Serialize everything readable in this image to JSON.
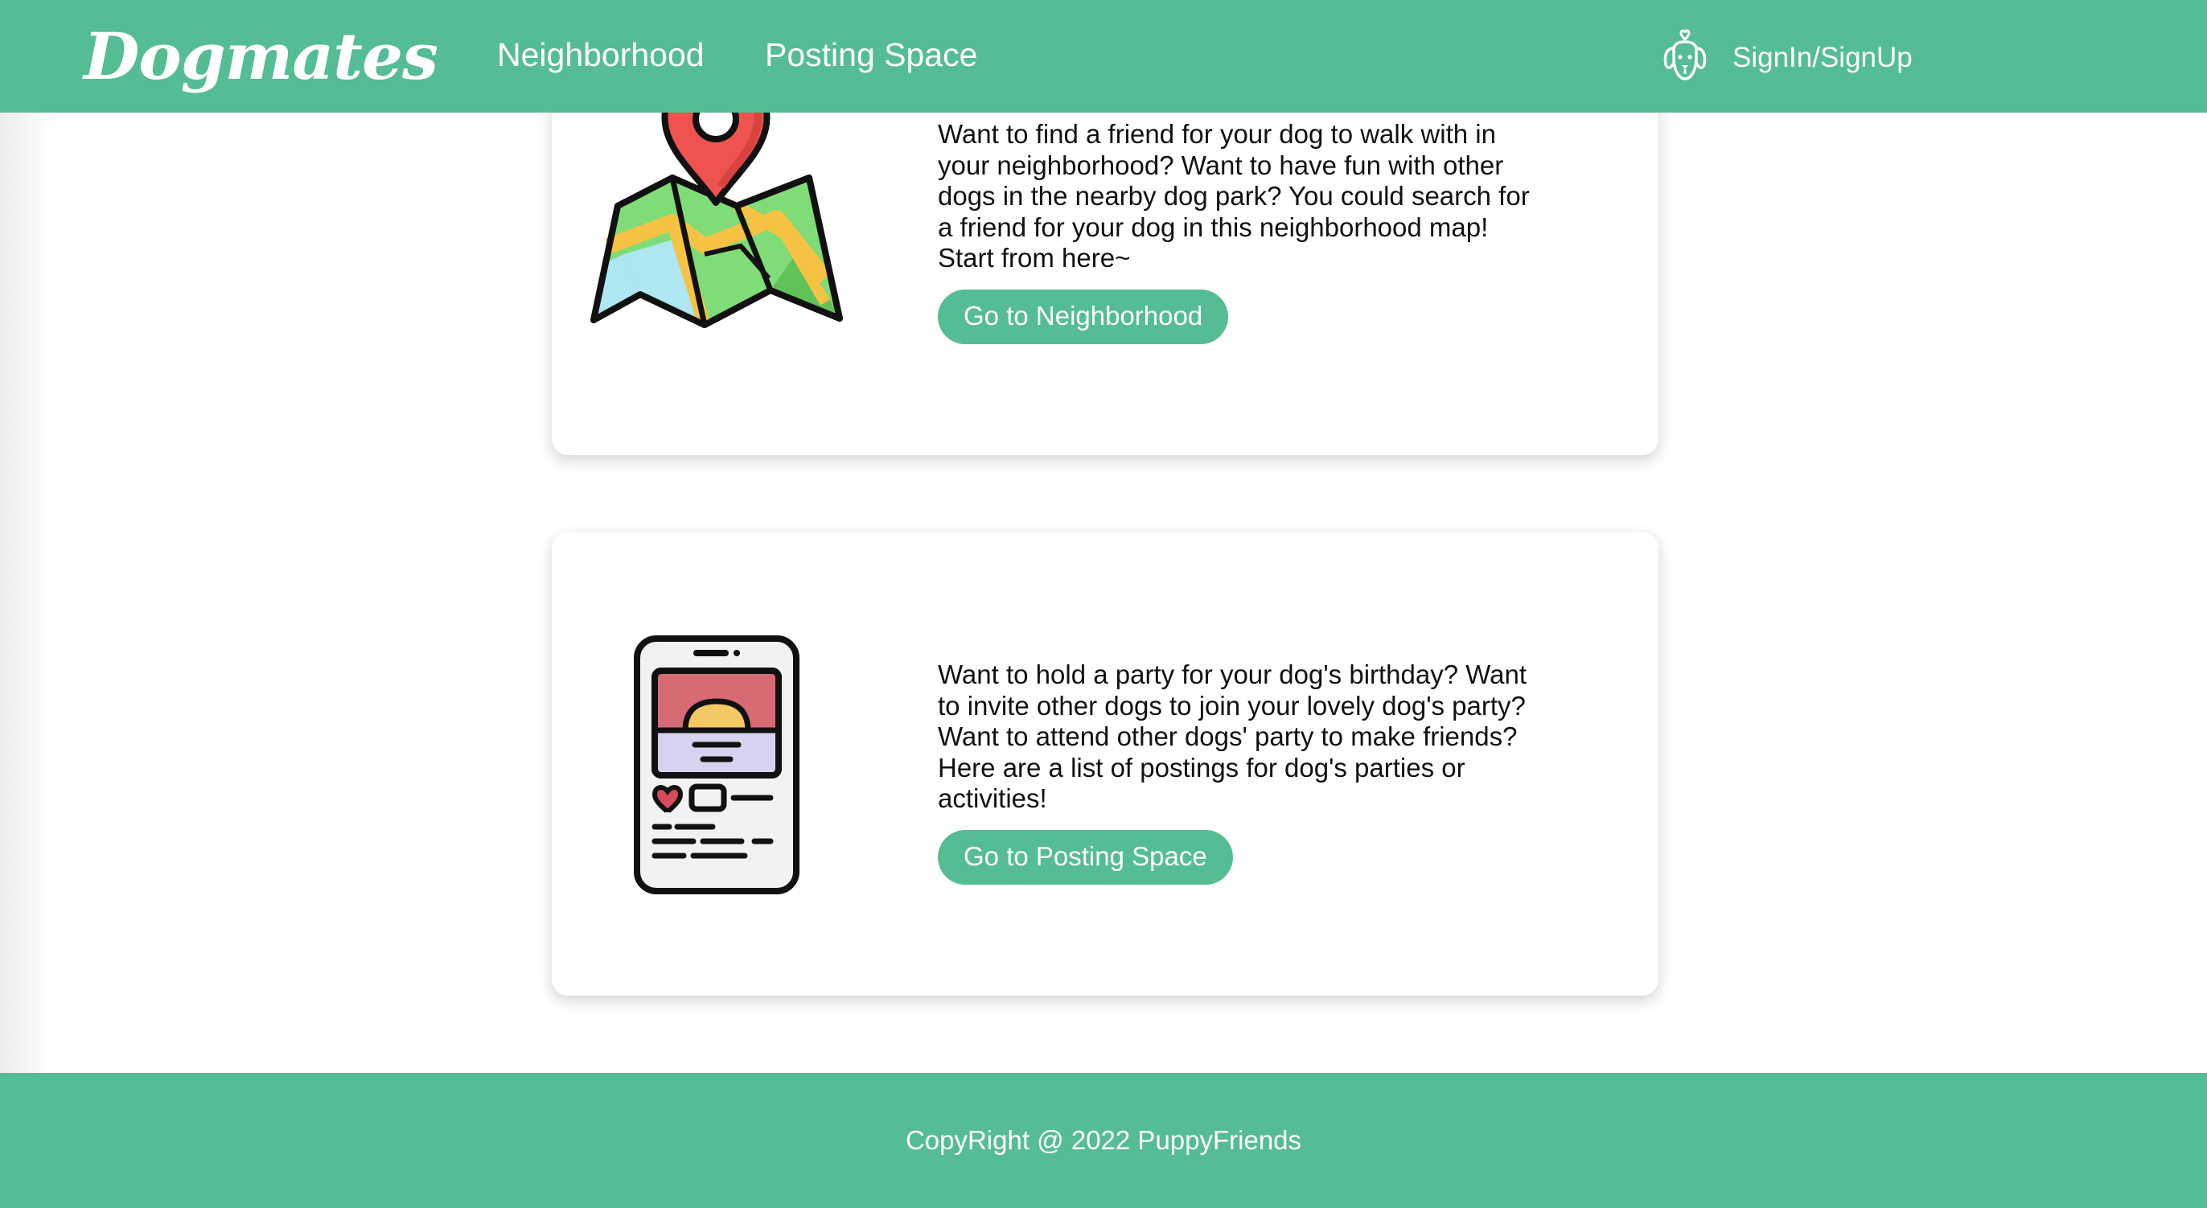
{
  "brand": {
    "name": "Dogmates"
  },
  "nav": {
    "links": [
      {
        "label": "Neighborhood"
      },
      {
        "label": "Posting Space"
      }
    ],
    "auth": {
      "label": "SignIn/SignUp",
      "icon": "dog-face-icon"
    }
  },
  "cards": [
    {
      "icon": "map-pin-icon",
      "text": "Want to find a friend for your dog to walk with in your neighborhood? Want to have fun with other dogs in the nearby dog park? You could search for a friend for your dog in this neighborhood map! Start from here~",
      "button": "Go to Neighborhood"
    },
    {
      "icon": "phone-post-icon",
      "text": "Want to hold a party for your dog's birthday? Want to invite other dogs to join your lovely dog's party? Want to attend other dogs' party to make friends? Here are a list of postings for dog's parties or activities!",
      "button": "Go to Posting Space"
    }
  ],
  "footer": {
    "text": "CopyRight @ 2022 PuppyFriends"
  },
  "colors": {
    "accent": "#55bd93",
    "card_bg": "#ffffff",
    "text": "#111111"
  }
}
